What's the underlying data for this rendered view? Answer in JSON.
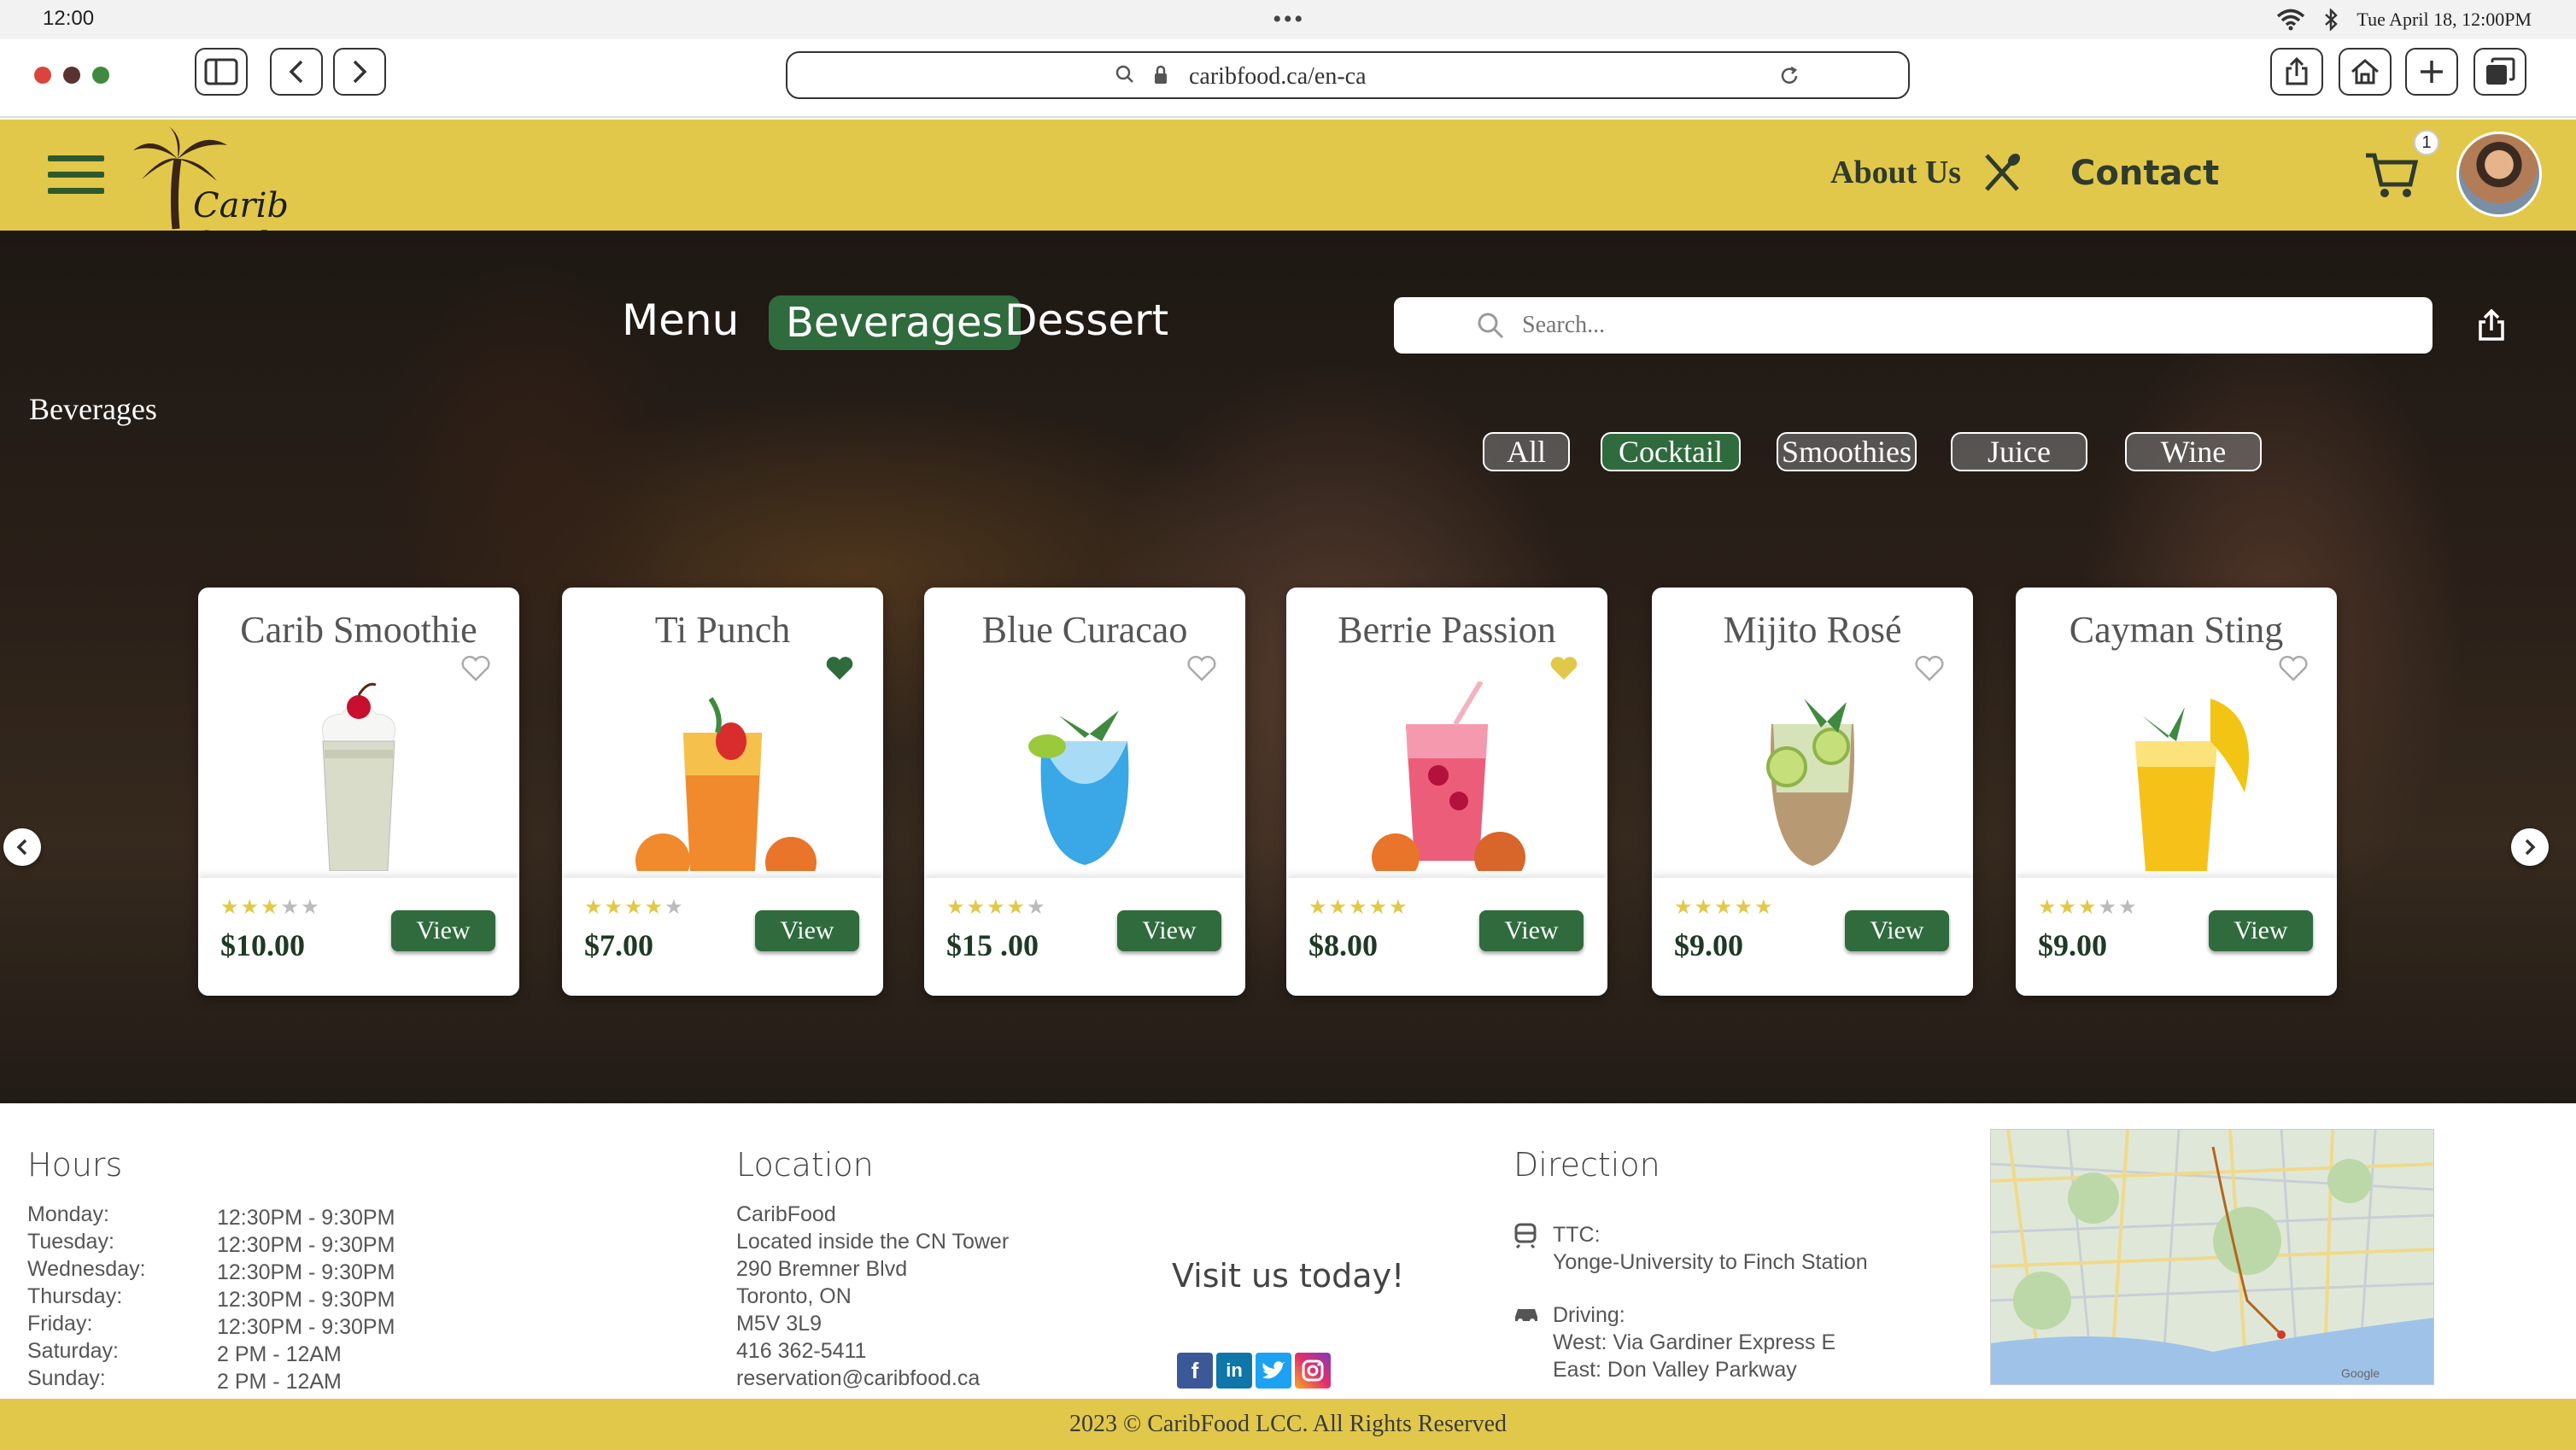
{
  "status": {
    "time": "12:00",
    "dots": "•••",
    "datetime": "Tue April 18, 12:00PM"
  },
  "browser": {
    "url": "caribfood.ca/en-ca"
  },
  "header": {
    "logo_text": "Carib food",
    "about": "About Us",
    "contact": "Contact",
    "cart_count": "1"
  },
  "hero": {
    "tabs": [
      "Menu",
      "Beverages",
      "Dessert"
    ],
    "active_tab": "Beverages",
    "page_label": "Beverages",
    "search_placeholder": "Search...",
    "filters": [
      "All",
      "Cocktail",
      "Smoothies",
      "Juice",
      "Wine"
    ],
    "active_filter": "Cocktail"
  },
  "products": [
    {
      "name": "Carib Smoothie",
      "price": "$10.00",
      "rating": 3,
      "favorite": "none",
      "drink": "smoothie",
      "view": "View"
    },
    {
      "name": "Ti Punch",
      "price": "$7.00",
      "rating": 4,
      "favorite": "green",
      "drink": "punch",
      "view": "View"
    },
    {
      "name": "Blue Curacao",
      "price": "$15 .00",
      "rating": 4,
      "favorite": "none",
      "drink": "blue",
      "view": "View"
    },
    {
      "name": "Berrie Passion",
      "price": "$8.00",
      "rating": 5,
      "favorite": "gold",
      "drink": "berry",
      "view": "View"
    },
    {
      "name": "Mijito Rosé",
      "price": "$9.00",
      "rating": 5,
      "favorite": "none",
      "drink": "mojito",
      "view": "View"
    },
    {
      "name": "Cayman Sting",
      "price": "$9.00",
      "rating": 3,
      "favorite": "none",
      "drink": "sting",
      "view": "View"
    }
  ],
  "footer": {
    "hours_title": "Hours",
    "hours": [
      {
        "day": "Monday:",
        "time": "12:30PM - 9:30PM"
      },
      {
        "day": "Tuesday:",
        "time": "12:30PM - 9:30PM"
      },
      {
        "day": "Wednesday:",
        "time": "12:30PM - 9:30PM"
      },
      {
        "day": "Thursday:",
        "time": "12:30PM - 9:30PM"
      },
      {
        "day": "Friday:",
        "time": "12:30PM - 9:30PM"
      },
      {
        "day": "Saturday:",
        "time": "2 PM - 12AM"
      },
      {
        "day": "Sunday:",
        "time": "2 PM - 12AM"
      }
    ],
    "location_title": "Location",
    "location_lines": [
      "CaribFood",
      "Located inside the CN Tower",
      "290 Bremner Blvd",
      "Toronto, ON",
      "M5V 3L9",
      "416 362-5411",
      "reservation@caribfood.ca"
    ],
    "visit": "Visit us today!",
    "direction_title": "Direction",
    "ttc_label": "TTC:",
    "ttc_route": "Yonge-University to Finch Station",
    "driving_label": "Driving:",
    "driving_west": "West: Via Gardiner Express E",
    "driving_east": "East: Don Valley Parkway",
    "map_label": "Google"
  },
  "copyright": "2023 © CaribFood LCC. All Rights Reserved",
  "colors": {
    "header_yellow": "#e2c84a",
    "brand_green": "#2f6b3d",
    "star_gold": "#e2c84a"
  }
}
